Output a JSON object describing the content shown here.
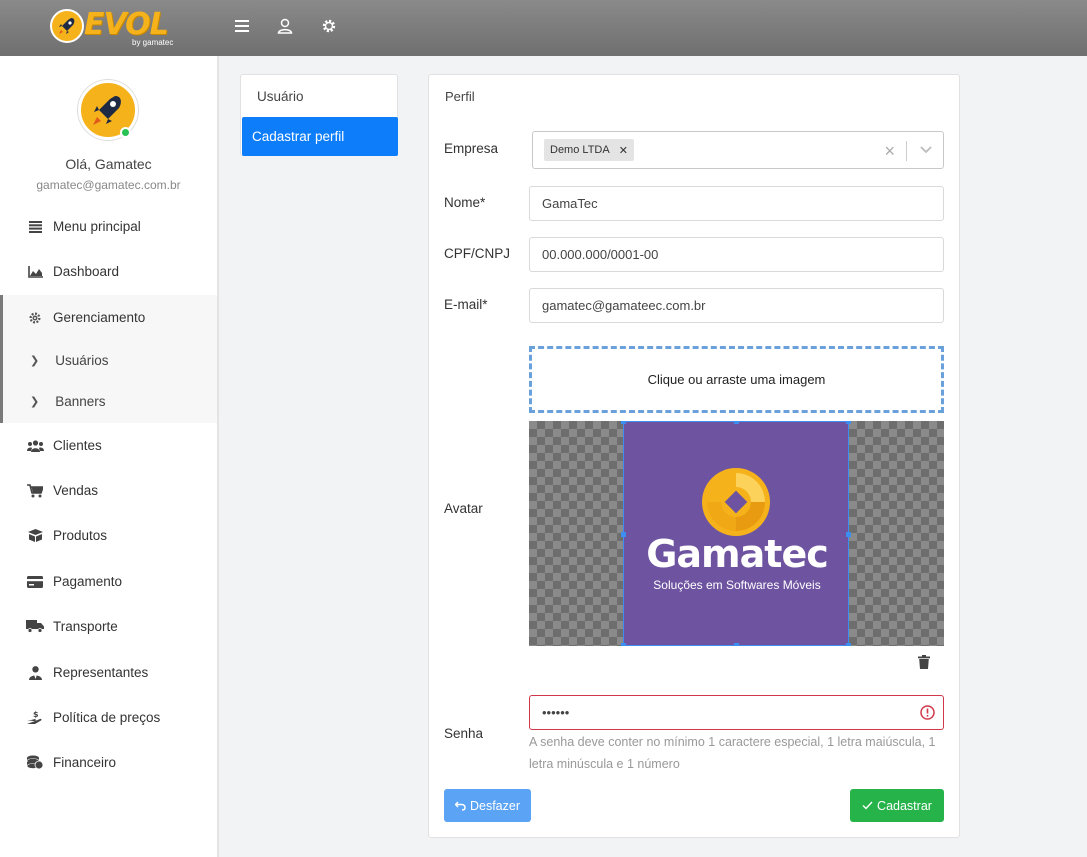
{
  "header": {
    "logo_text": "EVOL",
    "logo_sub": "by gamatec",
    "icons": [
      "menu-icon",
      "user-icon",
      "gear-icon"
    ]
  },
  "sidebar": {
    "greeting": "Olá, Gamatec",
    "email": "gamatec@gamatec.com.br",
    "items": [
      {
        "label": "Menu principal",
        "icon": "list-icon"
      },
      {
        "label": "Dashboard",
        "icon": "area-chart-icon"
      },
      {
        "label": "Gerenciamento",
        "icon": "gear-icon"
      },
      {
        "label": "Usuários",
        "icon": "chevron-right-icon"
      },
      {
        "label": "Banners",
        "icon": "chevron-right-icon"
      },
      {
        "label": "Clientes",
        "icon": "users-icon"
      },
      {
        "label": "Vendas",
        "icon": "cart-icon"
      },
      {
        "label": "Produtos",
        "icon": "box-icon"
      },
      {
        "label": "Pagamento",
        "icon": "credit-card-icon"
      },
      {
        "label": "Transporte",
        "icon": "truck-icon"
      },
      {
        "label": "Representantes",
        "icon": "person-tie-icon"
      },
      {
        "label": "Política de preços",
        "icon": "hand-money-icon"
      },
      {
        "label": "Financeiro",
        "icon": "coins-icon"
      }
    ]
  },
  "menu": {
    "header": "Usuário",
    "active": "Cadastrar perfil"
  },
  "form": {
    "title": "Perfil",
    "empresa": {
      "label": "Empresa",
      "tag": "Demo LTDA"
    },
    "nome": {
      "label": "Nome*",
      "value": "GamaTec"
    },
    "cpf": {
      "label": "CPF/CNPJ",
      "value": "00.000.000/0001-00"
    },
    "email": {
      "label": "E-mail*",
      "value": "gamatec@gamateec.com.br"
    },
    "avatar": {
      "label": "Avatar",
      "dropzone": "Clique ou arraste uma imagem",
      "image_name": "Gamatec",
      "image_tagline": "Soluções em Softwares Móveis"
    },
    "senha": {
      "label": "Senha",
      "value": "••••••",
      "hint": "A senha deve conter no mínimo 1 caractere especial, 1 letra maiúscula, 1 letra minúscula e 1 número"
    },
    "buttons": {
      "undo": "Desfazer",
      "save": "Cadastrar"
    }
  },
  "colors": {
    "primary": "#0d7dfa",
    "success": "#26b34a",
    "error": "#d0384a",
    "brand_yellow": "#f5b21b",
    "brand_purple": "#6e54a0"
  }
}
